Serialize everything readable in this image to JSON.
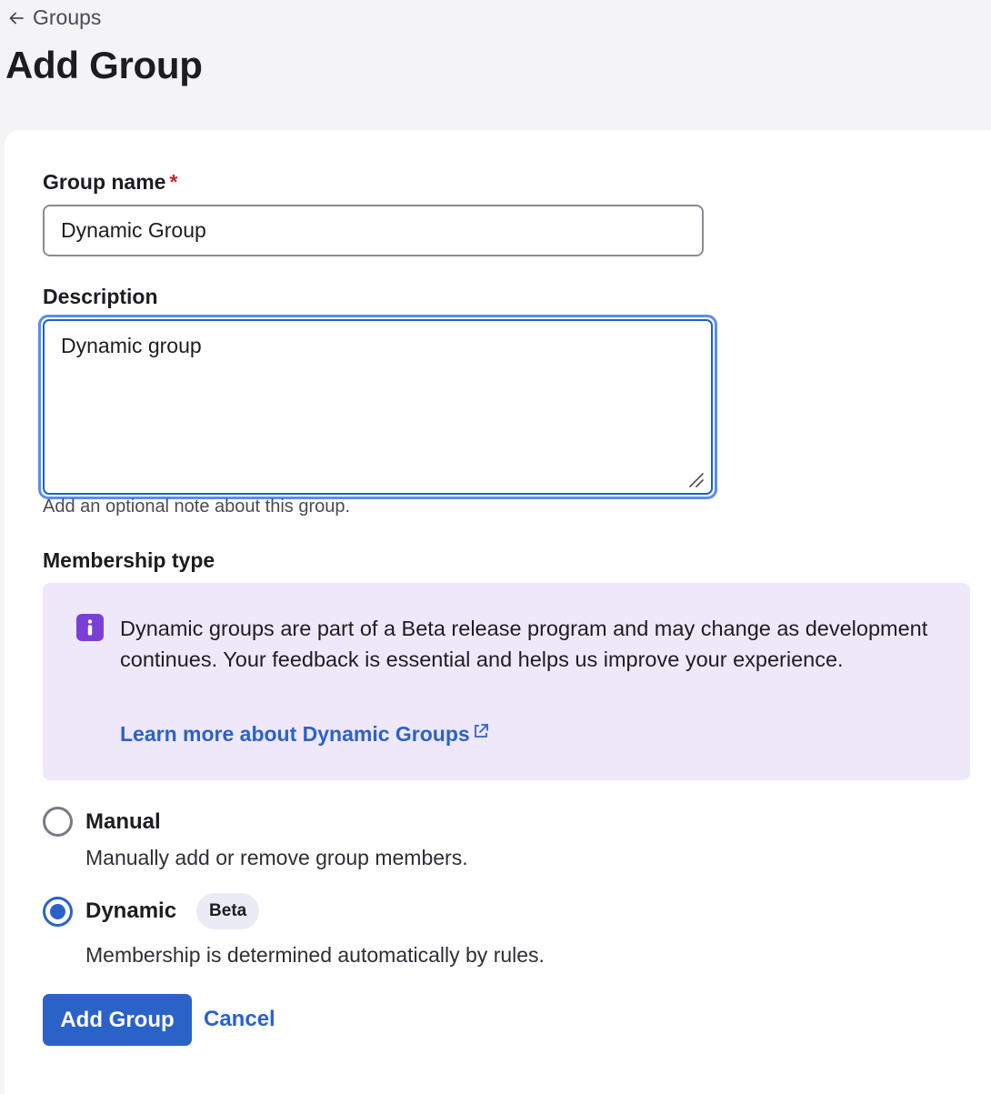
{
  "breadcrumb": {
    "back_label": "Groups"
  },
  "page": {
    "title": "Add Group"
  },
  "form": {
    "group_name": {
      "label": "Group name",
      "required_mark": "*",
      "value": "Dynamic Group"
    },
    "description": {
      "label": "Description",
      "value": "Dynamic group",
      "hint": "Add an optional note about this group."
    },
    "membership": {
      "label": "Membership type",
      "banner": {
        "text": "Dynamic groups are part of a Beta release program and may change as development continues. Your feedback is essential and helps us improve your experience.",
        "link_label": "Learn more about Dynamic Groups"
      },
      "options": [
        {
          "label": "Manual",
          "description": "Manually add or remove group members.",
          "selected": false
        },
        {
          "label": "Dynamic",
          "badge": "Beta",
          "description": "Membership is determined automatically by rules.",
          "selected": true
        }
      ]
    },
    "actions": {
      "submit_label": "Add Group",
      "cancel_label": "Cancel"
    }
  },
  "colors": {
    "primary": "#2b62c8",
    "banner_bg": "#efe8fb",
    "info_icon": "#7b3fd6",
    "required": "#c0282d",
    "focus_ring": "#5b8def"
  },
  "icons": {
    "back": "arrow-left-icon",
    "info": "info-icon",
    "external": "external-link-icon",
    "resize": "resize-grip-icon"
  }
}
